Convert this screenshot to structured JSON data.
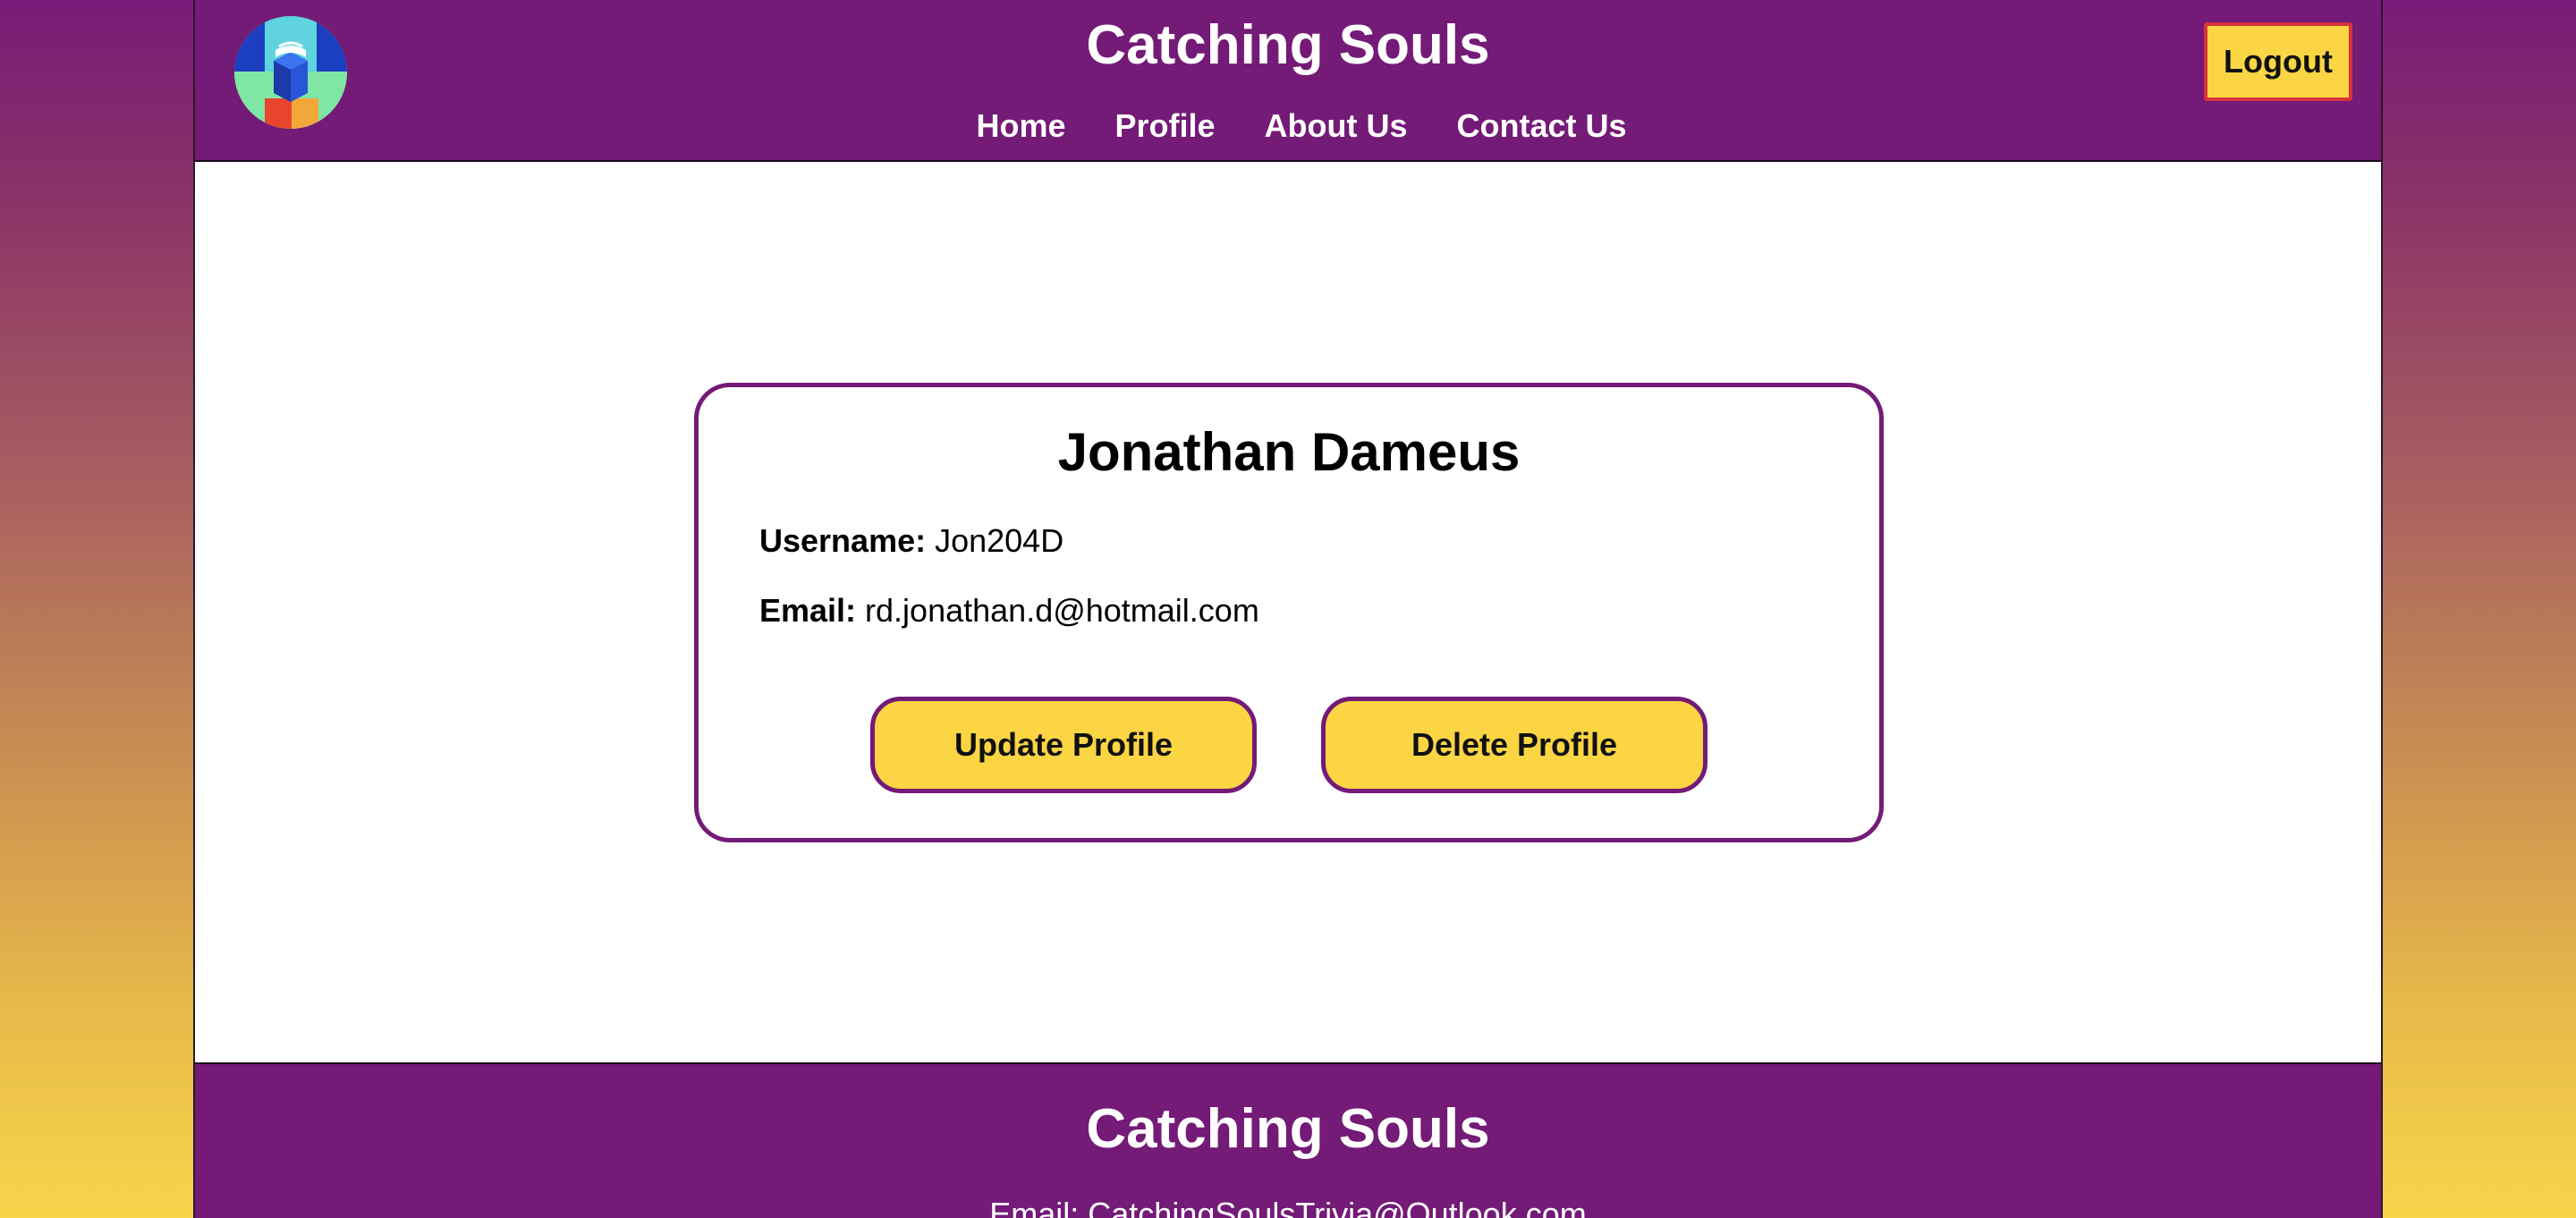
{
  "header": {
    "site_title": "Catching Souls",
    "logo_icon": "book-tower-logo-icon",
    "nav": [
      {
        "label": "Home"
      },
      {
        "label": "Profile"
      },
      {
        "label": "About Us"
      },
      {
        "label": "Contact Us"
      }
    ],
    "logout_label": "Logout"
  },
  "profile": {
    "name": "Jonathan Dameus",
    "username_label": "Username:",
    "username": "Jon204D",
    "email_label": "Email:",
    "email": "rd.jonathan.d@hotmail.com",
    "update_label": "Update Profile",
    "delete_label": "Delete Profile"
  },
  "footer": {
    "title": "Catching Souls",
    "email_text": "Email: CatchingSoulsTrivia@Outlook.com"
  },
  "colors": {
    "brand_purple": "#741a77",
    "button_yellow": "#fbd544",
    "logout_border": "#d8343c"
  }
}
